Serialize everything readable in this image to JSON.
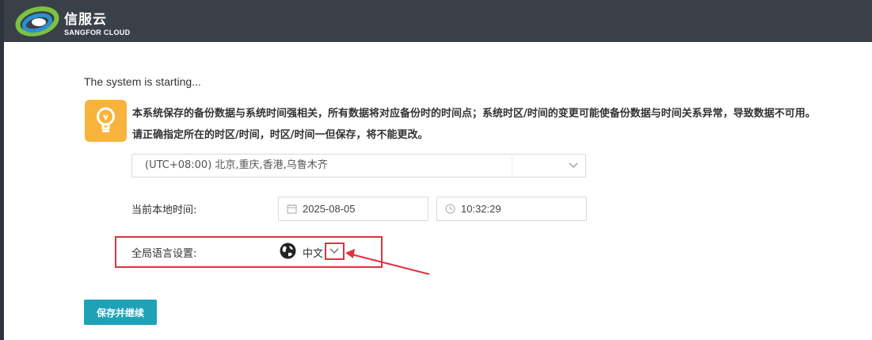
{
  "header": {
    "brand_cn": "信服云",
    "brand_en": "SANGFOR CLOUD",
    "colors": {
      "bar": "#3a4048",
      "logo_green": "#7cc242",
      "logo_blue": "#2c8fd1"
    }
  },
  "status_text": "The system is starting...",
  "notice": {
    "icon": "lightbulb-icon",
    "line1": "本系统保存的备份数据与系统时间强相关，所有数据将对应备份时的时间点；系统时区/时间的变更可能使备份数据与时间关系异常，导致数据不可用。",
    "line2": "请正确指定所在的时区/时间，时区/时间一但保存，将不能更改。"
  },
  "timezone": {
    "selected": "(UTC+08:00) 北京,重庆,香港,乌鲁木齐",
    "icon": "chevron-down-icon"
  },
  "local_time": {
    "label": "当前本地时间:",
    "date": "2025-08-05",
    "time": "10:32:29",
    "date_icon": "calendar-icon",
    "time_icon": "clock-icon"
  },
  "language": {
    "label": "全局语言设置:",
    "selected": "中文",
    "icon": "globe-icon",
    "dropdown_icon": "chevron-down-icon"
  },
  "save_button": "保存并继续",
  "colors": {
    "accent": "#1fa2b8",
    "warning": "#f7b33b",
    "annotation": "#e0323e"
  }
}
